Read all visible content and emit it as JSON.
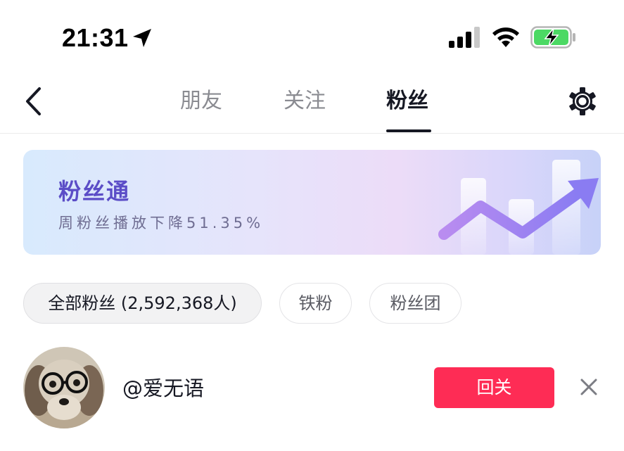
{
  "status_bar": {
    "time": "21:31",
    "icons": [
      "location-arrow-icon",
      "cellular-signal-icon",
      "wifi-icon",
      "battery-charging-icon"
    ],
    "battery_color": "#4cd964"
  },
  "nav": {
    "back_icon": "chevron-left-icon",
    "tabs": [
      {
        "label": "朋友",
        "active": false
      },
      {
        "label": "关注",
        "active": false
      },
      {
        "label": "粉丝",
        "active": true
      }
    ],
    "settings_icon": "gear-icon"
  },
  "banner": {
    "title": "粉丝通",
    "subtitle": "周粉丝播放下降51.35%",
    "title_color": "#5b4dc7"
  },
  "filters": [
    {
      "label": "全部粉丝 (2,592,368人)",
      "selected": true
    },
    {
      "label": "铁粉",
      "selected": false
    },
    {
      "label": "粉丝团",
      "selected": false
    }
  ],
  "followers": [
    {
      "username": "@爱无语",
      "avatar": "dog-with-glasses-avatar",
      "action_label": "回关",
      "action_color": "#fe2c55",
      "dismiss_icon": "close-icon"
    }
  ]
}
